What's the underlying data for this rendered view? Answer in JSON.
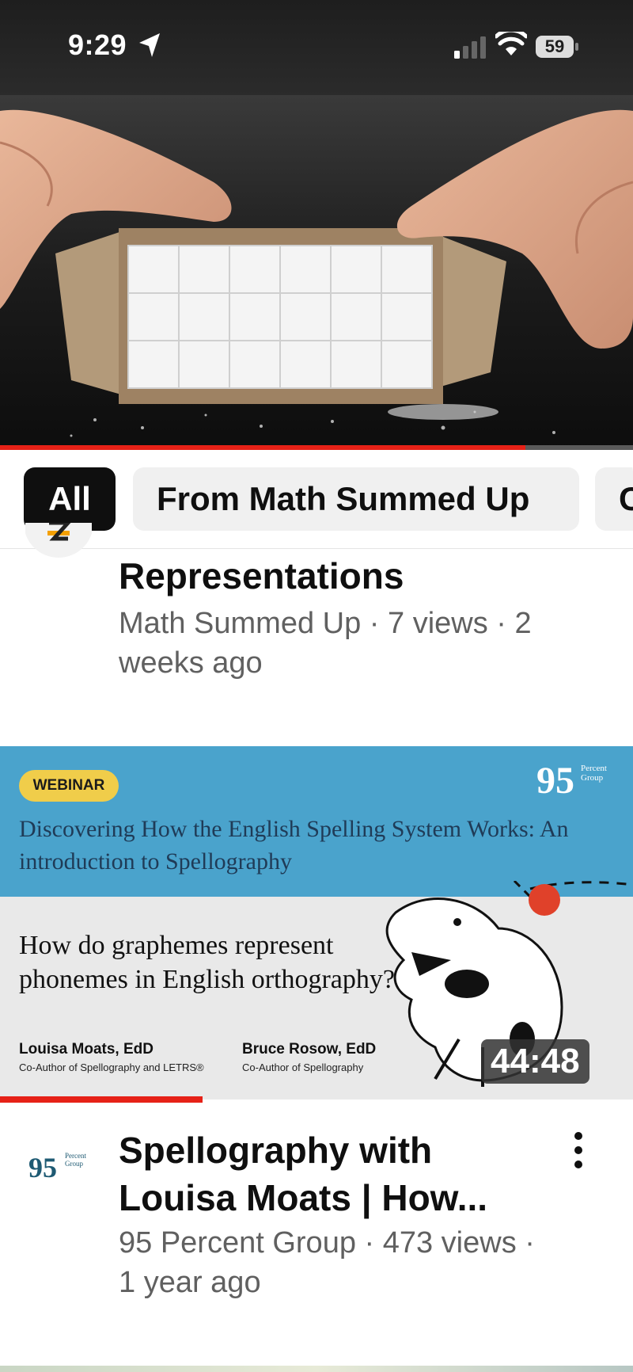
{
  "status_bar": {
    "time": "9:29",
    "battery": "59"
  },
  "player": {
    "progress_fraction": 0.83
  },
  "chips": {
    "all": "All",
    "math": "From Math Summed Up",
    "next": "C"
  },
  "item1": {
    "title": "Representations",
    "meta": "Math Summed Up · 7 views · 2 weeks ago"
  },
  "item2": {
    "thumbnail": {
      "badge": "WEBINAR",
      "brand_number": "95",
      "brand_line1": "Percent",
      "brand_line2": "Group",
      "headline": "Discovering How the English Spelling System Works: An introduction to Spellography",
      "question": "How do graphemes represent phonemes in English orthography?",
      "author1_name": "Louisa Moats, EdD",
      "author1_role": "Co-Author of Spellography and LETRS®",
      "author2_name": "Bruce Rosow, EdD",
      "author2_role": "Co-Author of Spellography",
      "duration": "44:48",
      "watched_fraction": 0.32
    },
    "avatar_number": "95",
    "avatar_line1": "Percent",
    "avatar_line2": "Group",
    "title": "Spellography with Louisa Moats | How...",
    "meta": "95 Percent Group  · 473 views · 1 year ago"
  },
  "colors": {
    "accent_red": "#e62117",
    "chip_selected": "#0f0f0f",
    "thumb_blue": "#4aa3cc",
    "badge_yellow": "#f0cd4a"
  }
}
